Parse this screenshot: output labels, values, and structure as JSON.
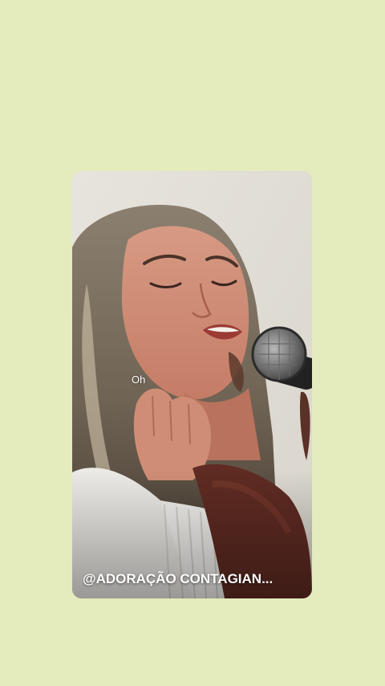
{
  "background_color": "#e4ebbd",
  "video": {
    "subtitle": "Oh",
    "channel_handle": "@ADORAÇÃO CONTAGIAN..."
  }
}
